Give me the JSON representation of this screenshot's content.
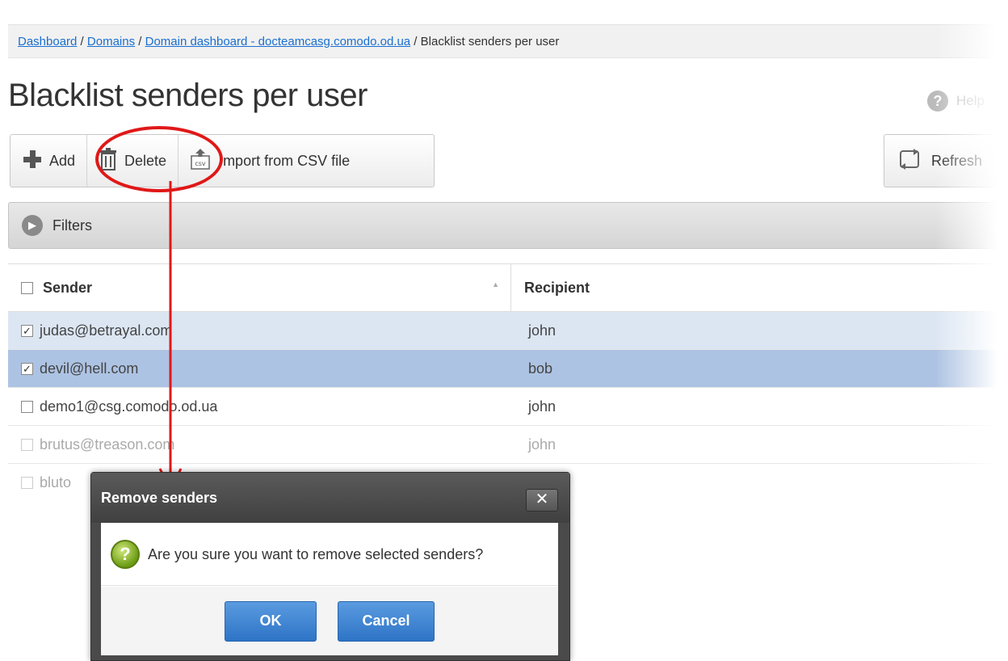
{
  "breadcrumb": {
    "items": [
      "Dashboard",
      "Domains",
      "Domain dashboard - docteamcasg.comodo.od.ua"
    ],
    "current": "Blacklist senders per user",
    "separator": " / "
  },
  "page": {
    "title": "Blacklist senders per user",
    "help_label": "Help"
  },
  "toolbar": {
    "add_label": "Add",
    "delete_label": "Delete",
    "import_label": "Import from CSV file",
    "refresh_label": "Refresh"
  },
  "filters": {
    "label": "Filters"
  },
  "table": {
    "columns": [
      "Sender",
      "Recipient"
    ],
    "rows": [
      {
        "sender": "judas@betrayal.com",
        "recipient": "john",
        "checked": true
      },
      {
        "sender": "devil@hell.com",
        "recipient": "bob",
        "checked": true
      },
      {
        "sender": "demo1@csg.comodo.od.ua",
        "recipient": "john",
        "checked": false
      },
      {
        "sender": "brutus@treason.com",
        "recipient": "john",
        "checked": false
      },
      {
        "sender": "bluto",
        "recipient": "",
        "checked": false
      }
    ]
  },
  "dialog": {
    "title": "Remove senders",
    "close_glyph": "✕",
    "message": "Are you sure you want to remove selected senders?",
    "ok_label": "OK",
    "cancel_label": "Cancel"
  },
  "icons": {
    "add": "plus-icon",
    "delete": "trash-icon",
    "import": "csv-import-icon",
    "refresh": "refresh-icon",
    "filters": "chevron-right-circle-icon",
    "help": "help-icon",
    "question": "question-icon"
  },
  "colors": {
    "link": "#1a6fd0",
    "selected_row_light": "#dce6f3",
    "selected_row_dark": "#adc3e3",
    "annotation": "#e01818",
    "dialog_button": "#2e74c6",
    "dialog_frame": "#4a4a4a"
  }
}
